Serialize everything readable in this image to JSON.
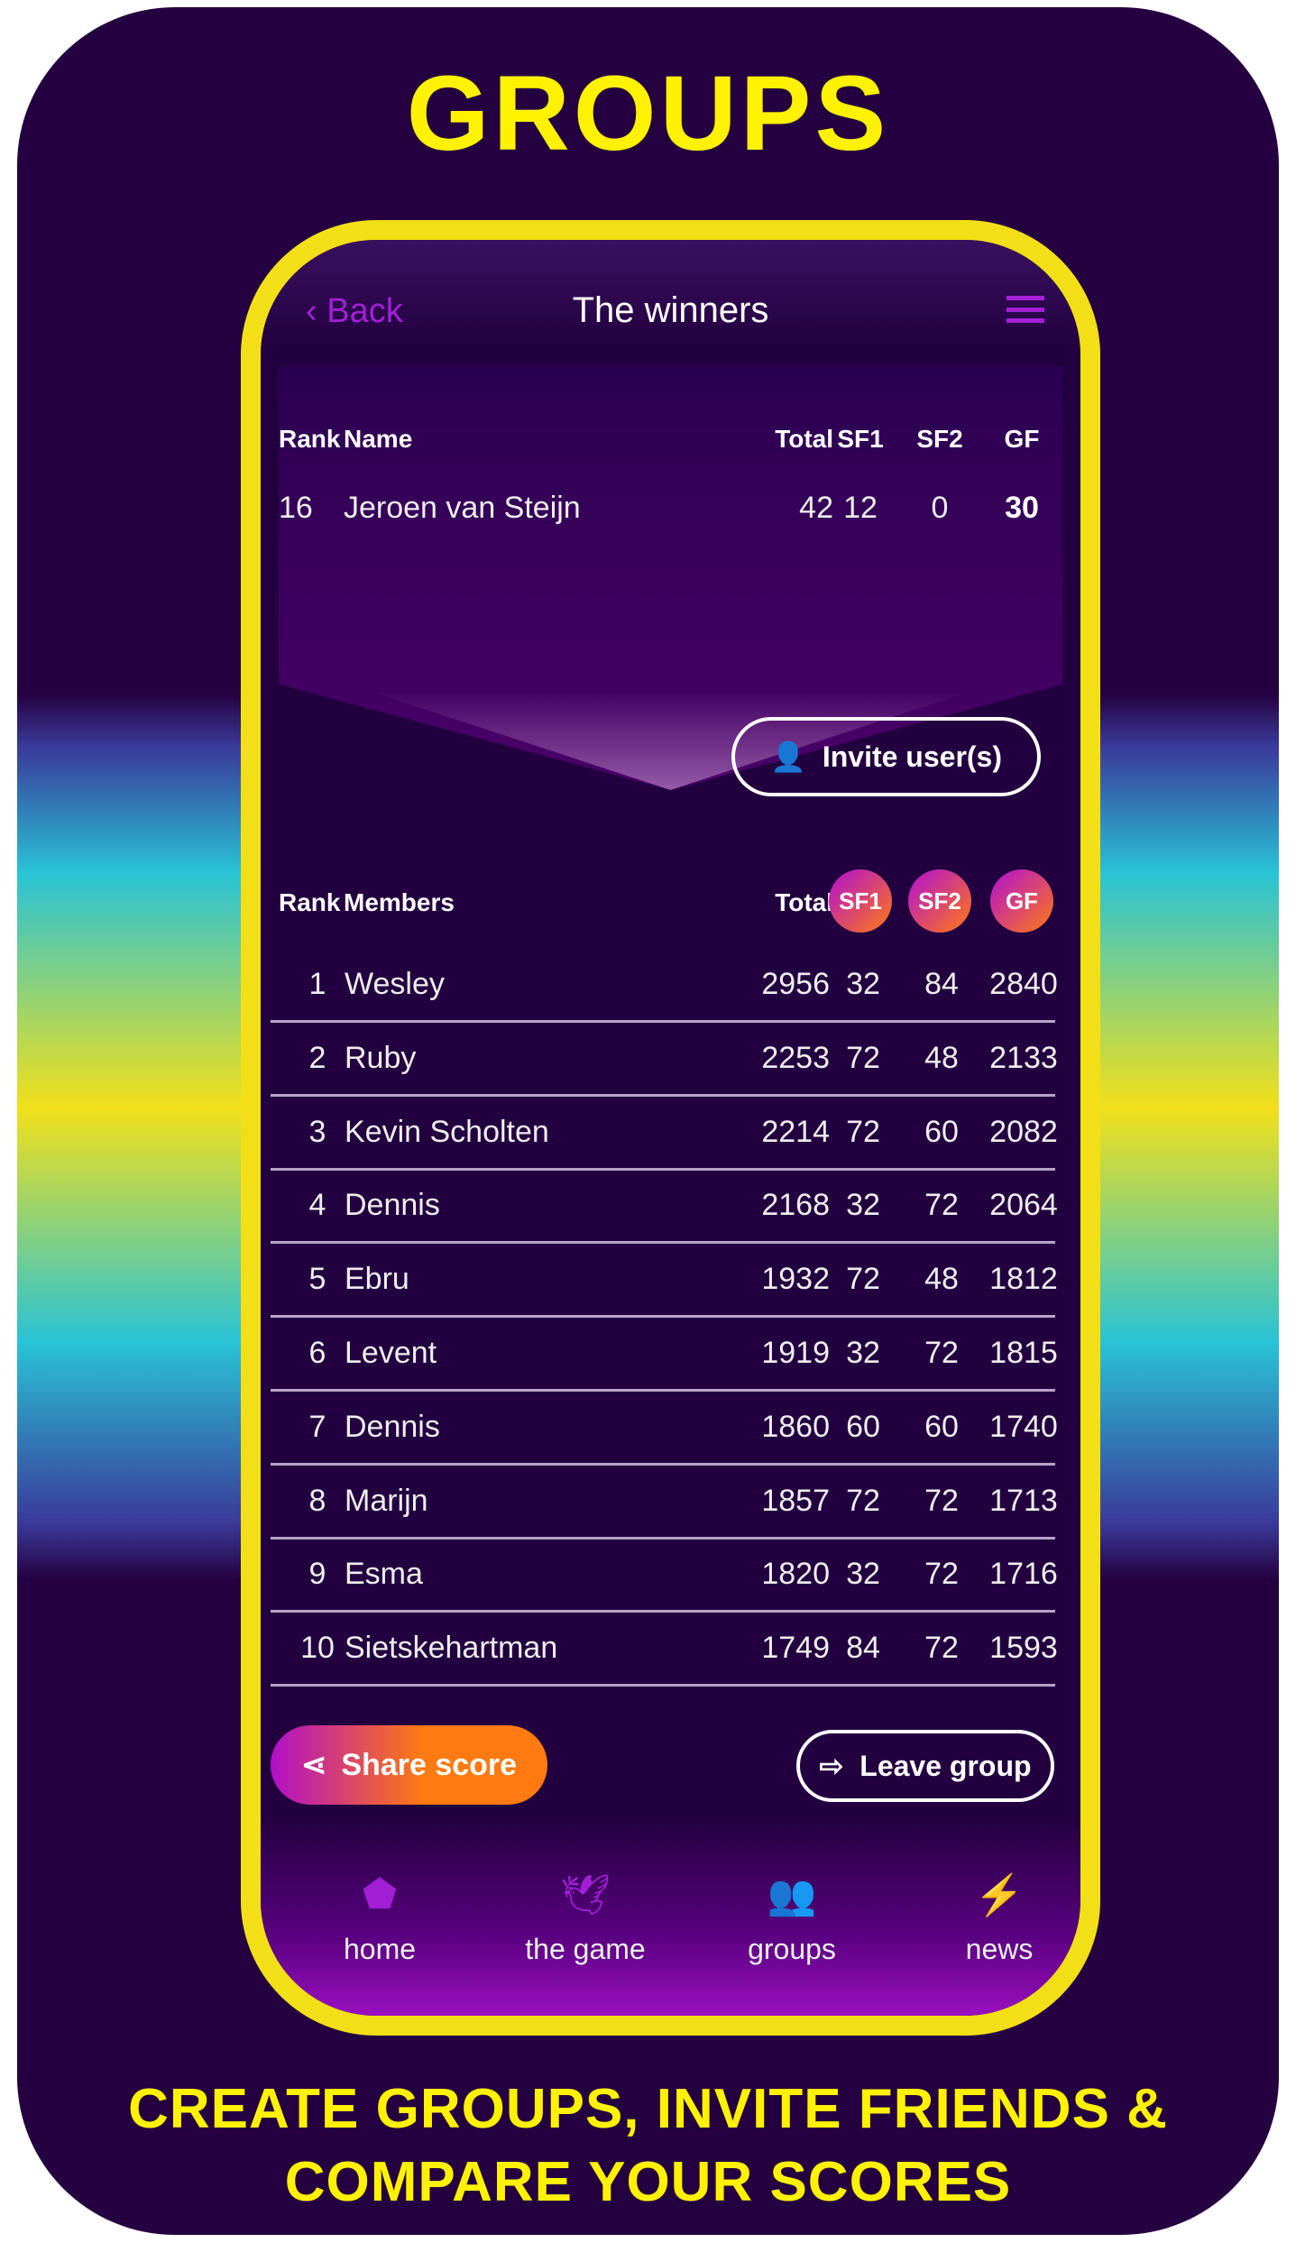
{
  "promo": {
    "title": "GROUPS",
    "tagline_line1": "CREATE GROUPS, INVITE FRIENDS &",
    "tagline_line2": "COMPARE YOUR SCORES",
    "frame_color": "#f3df17",
    "text_color": "#fff200"
  },
  "header": {
    "back_label": "Back",
    "title": "The winners",
    "menu_icon": "hamburger-icon"
  },
  "my_score": {
    "headers": {
      "rank": "Rank",
      "name": "Name",
      "total": "Total",
      "sf1": "SF1",
      "sf2": "SF2",
      "gf": "GF"
    },
    "row": {
      "rank": "16",
      "name": "Jeroen van Steijn",
      "total": "42",
      "sf1": "12",
      "sf2": "0",
      "gf": "30"
    }
  },
  "invite_label": "Invite user(s)",
  "members": {
    "headers": {
      "rank": "Rank",
      "name": "Members",
      "total": "Total",
      "sf1": "SF1",
      "sf2": "SF2",
      "gf": "GF"
    },
    "rows": [
      {
        "rank": "1",
        "name": "Wesley",
        "total": "2956",
        "sf1": "32",
        "sf2": "84",
        "gf": "2840"
      },
      {
        "rank": "2",
        "name": "Ruby",
        "total": "2253",
        "sf1": "72",
        "sf2": "48",
        "gf": "2133"
      },
      {
        "rank": "3",
        "name": "Kevin Scholten",
        "total": "2214",
        "sf1": "72",
        "sf2": "60",
        "gf": "2082"
      },
      {
        "rank": "4",
        "name": "Dennis",
        "total": "2168",
        "sf1": "32",
        "sf2": "72",
        "gf": "2064"
      },
      {
        "rank": "5",
        "name": "Ebru",
        "total": "1932",
        "sf1": "72",
        "sf2": "48",
        "gf": "1812"
      },
      {
        "rank": "6",
        "name": "Levent",
        "total": "1919",
        "sf1": "32",
        "sf2": "72",
        "gf": "1815"
      },
      {
        "rank": "7",
        "name": "Dennis",
        "total": "1860",
        "sf1": "60",
        "sf2": "60",
        "gf": "1740"
      },
      {
        "rank": "8",
        "name": "Marijn",
        "total": "1857",
        "sf1": "72",
        "sf2": "72",
        "gf": "1713"
      },
      {
        "rank": "9",
        "name": "Esma",
        "total": "1820",
        "sf1": "32",
        "sf2": "72",
        "gf": "1716"
      },
      {
        "rank": "10",
        "name": "Sietskehartman",
        "total": "1749",
        "sf1": "84",
        "sf2": "72",
        "gf": "1593"
      }
    ]
  },
  "actions": {
    "share_label": "Share score",
    "leave_label": "Leave group"
  },
  "nav": [
    {
      "label": "home",
      "icon": "home-icon"
    },
    {
      "label": "the game",
      "icon": "bird-icon"
    },
    {
      "label": "groups",
      "icon": "groups-icon"
    },
    {
      "label": "news",
      "icon": "lightning-icon"
    }
  ]
}
